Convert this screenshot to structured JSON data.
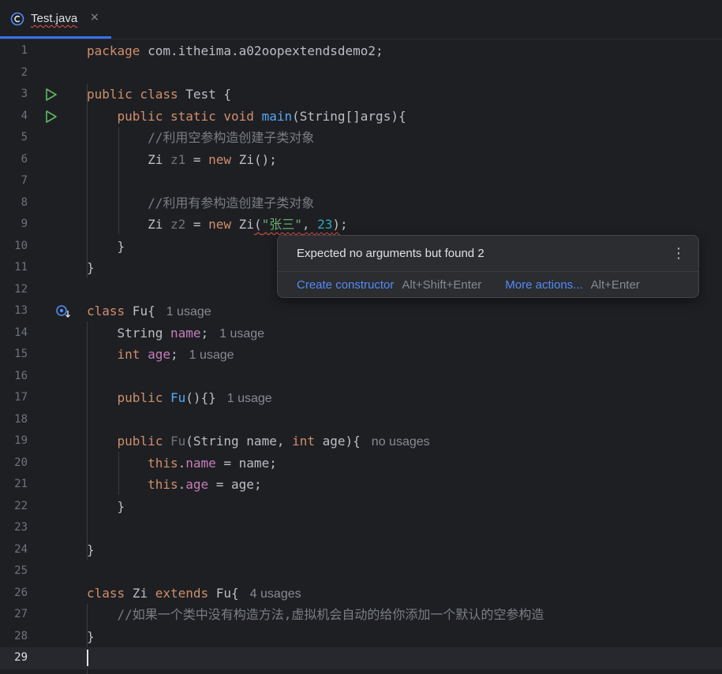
{
  "tab": {
    "filename": "Test.java",
    "close_glyph": "×",
    "icon": "java-class-icon",
    "active_color": "#3574f0"
  },
  "lines": [
    {
      "num": "1"
    },
    {
      "num": "2"
    },
    {
      "num": "3"
    },
    {
      "num": "4"
    },
    {
      "num": "5"
    },
    {
      "num": "6"
    },
    {
      "num": "7"
    },
    {
      "num": "8"
    },
    {
      "num": "9"
    },
    {
      "num": "10"
    },
    {
      "num": "11"
    },
    {
      "num": "12"
    },
    {
      "num": "13"
    },
    {
      "num": "14"
    },
    {
      "num": "15"
    },
    {
      "num": "16"
    },
    {
      "num": "17"
    },
    {
      "num": "18"
    },
    {
      "num": "19"
    },
    {
      "num": "20"
    },
    {
      "num": "21"
    },
    {
      "num": "22"
    },
    {
      "num": "23"
    },
    {
      "num": "24"
    },
    {
      "num": "25"
    },
    {
      "num": "26"
    },
    {
      "num": "27"
    },
    {
      "num": "28"
    },
    {
      "num": "29"
    }
  ],
  "code": {
    "l1_kw": "package",
    "l1_rest": " com.itheima.a02oopextendsdemo2;",
    "l3_kw": "public class",
    "l3_rest": " Test {",
    "l4_kw": "public static void",
    "l4_fn": "main",
    "l4_rest": "(String[]args){",
    "l5_cmt": "//利用空参构造创建子类对象",
    "l6_a": "Zi ",
    "l6_var": "z1",
    "l6_b": " = ",
    "l6_kw": "new",
    "l6_c": " Zi();",
    "l8_cmt": "//利用有参构造创建子类对象",
    "l9_a": "Zi ",
    "l9_var": "z2",
    "l9_b": " = ",
    "l9_kw": "new",
    "l9_c": " Zi",
    "l9_args_open": "(",
    "l9_str": "\"张三\"",
    "l9_comma": ", ",
    "l9_num": "23",
    "l9_args_close": ")",
    "l9_end": ";",
    "l10": "}",
    "l11": "}",
    "l13_kw": "class",
    "l13_rest": " Fu{",
    "l13_hint": "1 usage",
    "l14_a": "String ",
    "l14_fld": "name",
    "l14_b": ";",
    "l14_hint": "1 usage",
    "l15_kw": "int",
    "l15_fld": "age",
    "l15_b": ";",
    "l15_hint": "1 usage",
    "l17_kw": "public",
    "l17_fn": "Fu",
    "l17_rest": "(){}",
    "l17_hint": "1 usage",
    "l19_kw": "public",
    "l19_fn": "Fu",
    "l19_a": "(String name, ",
    "l19_kw2": "int",
    "l19_b": " age){",
    "l19_hint": "no usages",
    "l20_kw": "this",
    "l20_dot": ".",
    "l20_fld": "name",
    "l20_rest": " = name;",
    "l21_kw": "this",
    "l21_dot": ".",
    "l21_fld": "age",
    "l21_rest": " = age;",
    "l22": "}",
    "l24": "}",
    "l26_kw": "class",
    "l26_a": " Zi ",
    "l26_kw2": "extends",
    "l26_b": " Fu{",
    "l26_hint": "4 usages",
    "l27_cmt": "//如果一个类中没有构造方法,虚拟机会自动的给你添加一个默认的空参构造",
    "l28": "}"
  },
  "popup": {
    "message": "Expected no arguments but found 2",
    "menu_glyph": "⋮",
    "action1": "Create constructor",
    "shortcut1": "Alt+Shift+Enter",
    "action2": "More actions...",
    "shortcut2": "Alt+Enter"
  },
  "colors": {
    "background": "#1e1f22",
    "keyword": "#cf8e6d",
    "function": "#56a8f5",
    "field": "#c77dbb",
    "string": "#6aab73",
    "number": "#2aacb8",
    "comment": "#7a7e85",
    "error_underline": "#e5544c",
    "link": "#548af7"
  }
}
